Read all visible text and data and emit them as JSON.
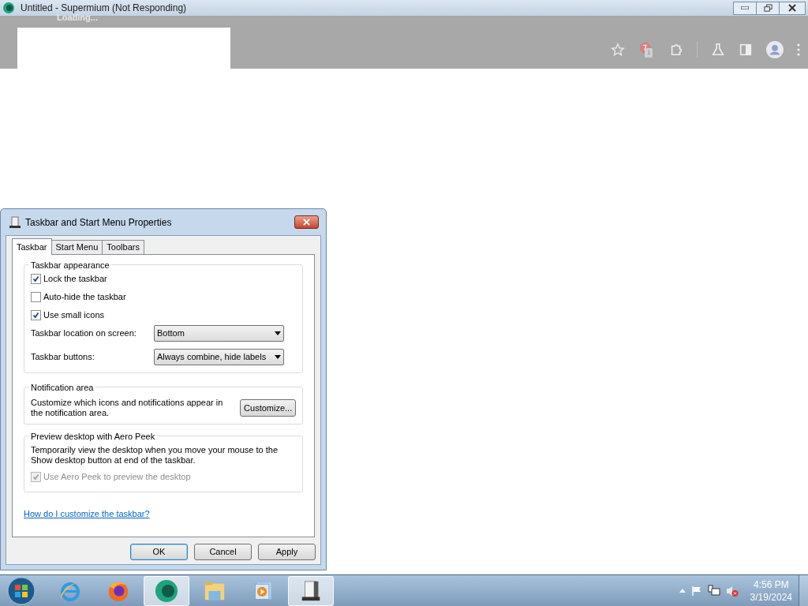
{
  "browser": {
    "title": "Untitled - Supermium (Not Responding)",
    "tab_title": "Loading...",
    "extension_badge": "1"
  },
  "dialog": {
    "title": "Taskbar and Start Menu Properties",
    "tabs": [
      {
        "label": "Taskbar",
        "selected": true
      },
      {
        "label": "Start Menu",
        "selected": false
      },
      {
        "label": "Toolbars",
        "selected": false
      }
    ],
    "appearance": {
      "legend": "Taskbar appearance",
      "checkboxes": [
        {
          "label": "Lock the taskbar",
          "checked": true
        },
        {
          "label": "Auto-hide the taskbar",
          "checked": false
        },
        {
          "label": "Use small icons",
          "checked": true
        }
      ],
      "selects": [
        {
          "label": "Taskbar location on screen:",
          "value": "Bottom"
        },
        {
          "label": "Taskbar buttons:",
          "value": "Always combine, hide labels"
        }
      ]
    },
    "notification": {
      "legend": "Notification area",
      "text": "Customize which icons and notifications appear in the notification area.",
      "button": "Customize..."
    },
    "aero_peek": {
      "legend": "Preview desktop with Aero Peek",
      "text": "Temporarily view the desktop when you move your mouse to the Show desktop button at end of the taskbar.",
      "checkbox": {
        "label": "Use Aero Peek to preview the desktop",
        "checked": true,
        "disabled": true
      }
    },
    "help_link": "How do I customize the taskbar?",
    "buttons": [
      {
        "label": "OK",
        "default": true
      },
      {
        "label": "Cancel",
        "default": false
      },
      {
        "label": "Apply",
        "default": false
      }
    ]
  },
  "taskbar": {
    "apps": [
      {
        "kind": "ie",
        "selected": false
      },
      {
        "kind": "firefox",
        "selected": false
      },
      {
        "kind": "supermium",
        "selected": true
      },
      {
        "kind": "explorer",
        "selected": false
      },
      {
        "kind": "media",
        "selected": false
      },
      {
        "kind": "properties",
        "selected": true
      }
    ],
    "time": "4:56 PM",
    "date": "3/19/2024"
  }
}
